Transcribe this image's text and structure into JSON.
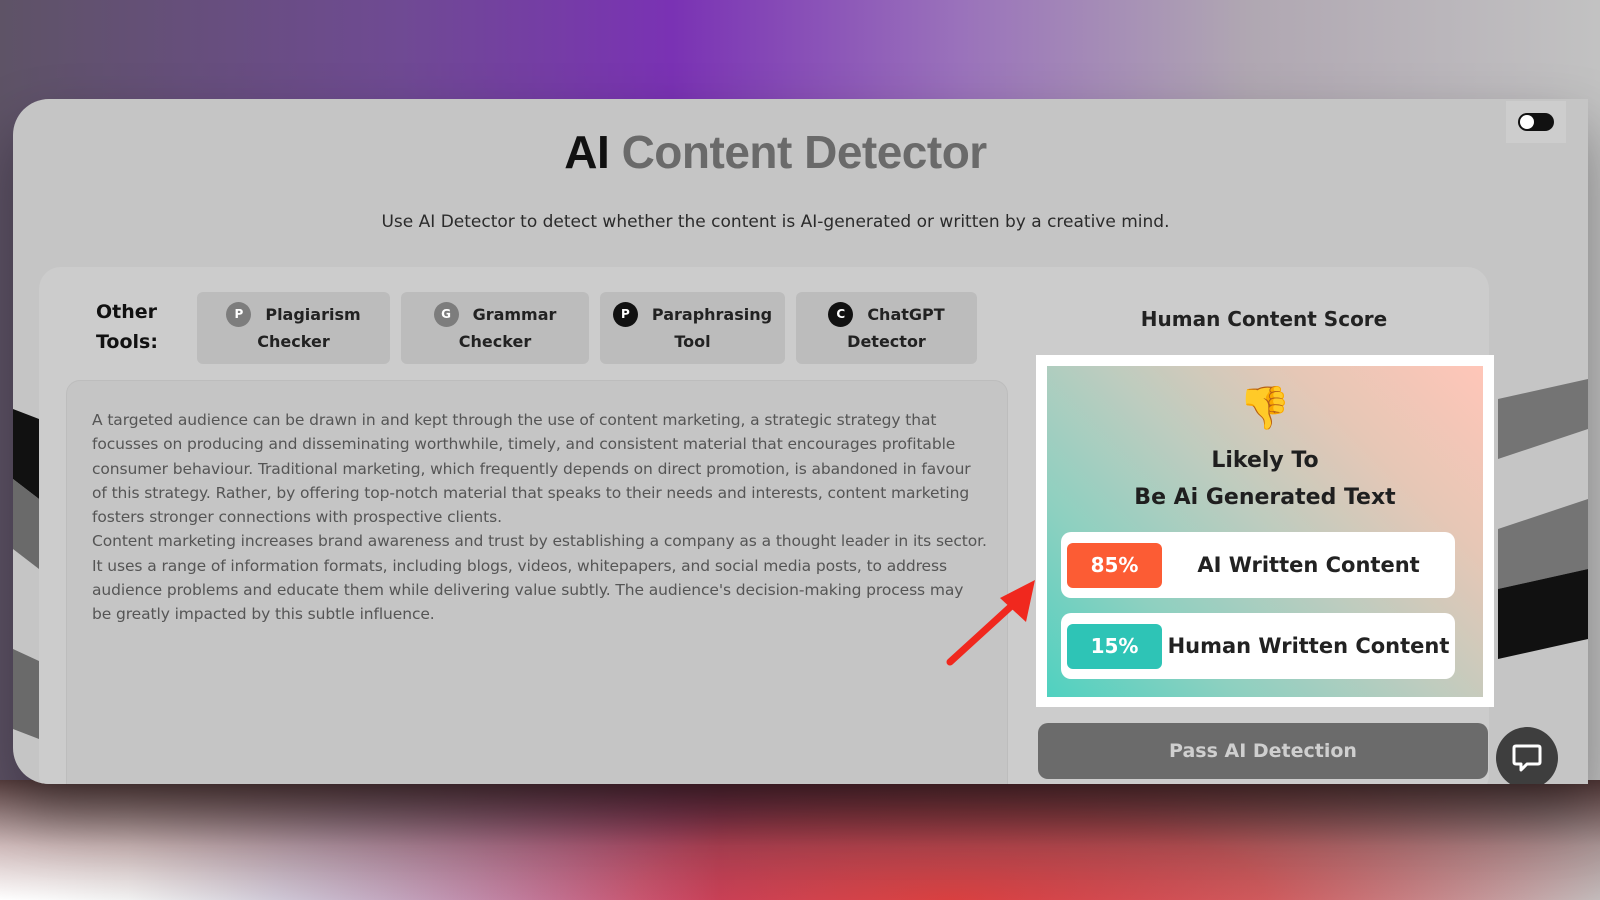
{
  "header": {
    "title_strong": "AI",
    "title_rest": "Content Detector",
    "subtitle": "Use AI Detector to detect whether the content is AI-generated or written by a creative mind."
  },
  "theme_toggle": {
    "icon": "toggle-icon",
    "state": "off"
  },
  "other_tools": {
    "label_line1": "Other",
    "label_line2": "Tools:",
    "items": [
      {
        "icon_letter": "P",
        "line1": "Plagiarism",
        "line2": "Checker"
      },
      {
        "icon_letter": "G",
        "line1": "Grammar",
        "line2": "Checker"
      },
      {
        "icon_letter": "P",
        "line1": "Paraphrasing",
        "line2": "Tool"
      },
      {
        "icon_letter": "C",
        "line1": "ChatGPT",
        "line2": "Detector"
      }
    ]
  },
  "input_text": {
    "paragraphs": [
      "A targeted audience can be drawn in and kept through the use of content marketing, a strategic strategy that focusses on producing and disseminating worthwhile, timely, and consistent material that encourages profitable consumer behaviour. Traditional marketing, which frequently depends on direct promotion, is abandoned in favour of this strategy. Rather, by offering top-notch material that speaks to their needs and interests, content marketing fosters stronger connections with prospective clients.",
      "Content marketing increases brand awareness and trust by establishing a company as a thought leader in its sector. It uses a range of information formats, including blogs, videos, whitepapers, and social media posts, to address audience problems and educate them while delivering value subtly. The audience's decision-making process may be greatly impacted by this subtle influence."
    ]
  },
  "score": {
    "title": "Human Content Score",
    "emoji": "👎",
    "verdict_line1": "Likely To",
    "verdict_line2": "Be Ai Generated Text",
    "results": [
      {
        "percent": "85%",
        "label": "AI Written Content",
        "color": "#fc5c34"
      },
      {
        "percent": "15%",
        "label": "Human Written Content",
        "color": "#2ec4b6"
      }
    ]
  },
  "pass_button": {
    "label": "Pass AI Detection"
  },
  "chat": {
    "icon": "chat-bubble-icon"
  },
  "annotation": {
    "icon": "red-arrow-icon",
    "color": "#f0281e"
  }
}
